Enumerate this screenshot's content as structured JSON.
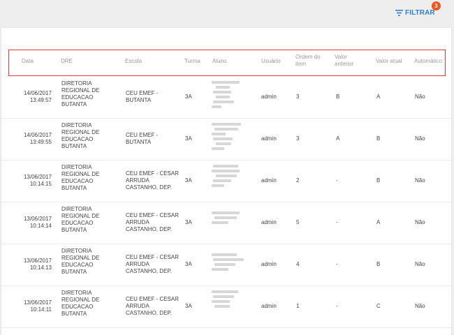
{
  "toolbar": {
    "filter_label": "FILTRAR",
    "filter_count": "3",
    "filter_icon": "filter-lines-icon",
    "accent_color": "#2b7fd6",
    "badge_color": "#f0571e"
  },
  "table": {
    "columns": [
      "Data",
      "DRE",
      "Escola",
      "Turma",
      "Aluno",
      "Usuário",
      "Ordem do item",
      "Valor anterior",
      "Valor atual",
      "Automático"
    ],
    "rows": [
      {
        "date": "14/06/2017",
        "time": "13:49:57",
        "dre": [
          "DIRETORIA",
          "REGIONAL DE",
          "EDUCACAO",
          "BUTANTA"
        ],
        "escola": [
          "CEU EMEF -",
          "BUTANTA"
        ],
        "turma": "3A",
        "usuario": "admin",
        "ordem": "3",
        "anterior": "B",
        "atual": "A",
        "automatico": "Não"
      },
      {
        "date": "14/06/2017",
        "time": "13:49:55",
        "dre": [
          "DIRETORIA",
          "REGIONAL DE",
          "EDUCACAO",
          "BUTANTA"
        ],
        "escola": [
          "CEU EMEF -",
          "BUTANTA"
        ],
        "turma": "3A",
        "usuario": "admin",
        "ordem": "3",
        "anterior": "A",
        "atual": "B",
        "automatico": "Não"
      },
      {
        "date": "13/06/2017",
        "time": "10:14:15",
        "dre": [
          "DIRETORIA",
          "REGIONAL DE",
          "EDUCACAO",
          "BUTANTA"
        ],
        "escola": [
          "CEU EMEF - CESAR",
          "ARRUDA",
          "CASTANHO, DEP."
        ],
        "turma": "3A",
        "usuario": "admin",
        "ordem": "2",
        "anterior": "-",
        "atual": "B",
        "automatico": "Não"
      },
      {
        "date": "13/06/2017",
        "time": "10:14:14",
        "dre": [
          "DIRETORIA",
          "REGIONAL DE",
          "EDUCACAO",
          "BUTANTA"
        ],
        "escola": [
          "CEU EMEF - CESAR",
          "ARRUDA",
          "CASTANHO, DEP."
        ],
        "turma": "3A",
        "usuario": "admin",
        "ordem": "5",
        "anterior": "-",
        "atual": "A",
        "automatico": "Não"
      },
      {
        "date": "13/06/2017",
        "time": "10:14:13",
        "dre": [
          "DIRETORIA",
          "REGIONAL DE",
          "EDUCACAO",
          "BUTANTA"
        ],
        "escola": [
          "CEU EMEF - CESAR",
          "ARRUDA",
          "CASTANHO, DEP."
        ],
        "turma": "3A",
        "usuario": "admin",
        "ordem": "4",
        "anterior": "-",
        "atual": "B",
        "automatico": "Não"
      },
      {
        "date": "13/06/2017",
        "time": "10:14:11",
        "dre": [
          "DIRETORIA",
          "REGIONAL DE",
          "EDUCACAO",
          "BUTANTA"
        ],
        "escola": [
          "CEU EMEF - CESAR",
          "ARRUDA",
          "CASTANHO, DEP."
        ],
        "turma": "3A",
        "usuario": "admin",
        "ordem": "1",
        "anterior": "-",
        "atual": "C",
        "automatico": "Não"
      }
    ]
  }
}
